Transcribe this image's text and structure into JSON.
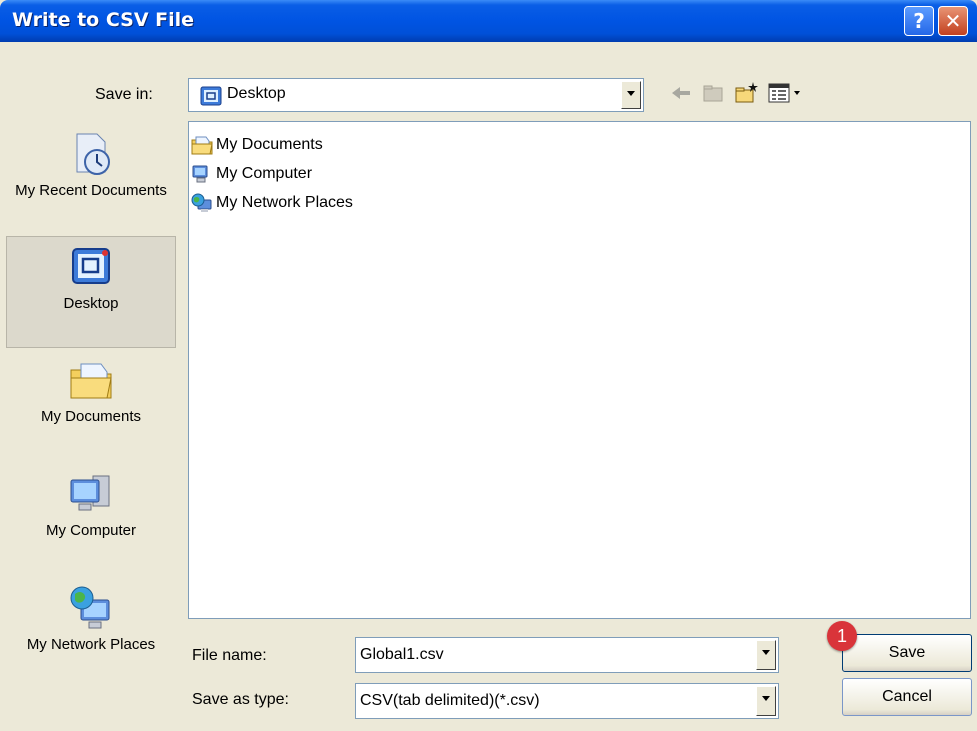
{
  "window": {
    "title": "Write to CSV File",
    "help_label": "?",
    "close_label": "✕"
  },
  "save_in": {
    "label": "Save in:",
    "value": "Desktop",
    "icon": "desktop-icon"
  },
  "toolbar": {
    "back_icon": "back-arrow-icon",
    "up_icon": "up-folder-icon",
    "new_folder_icon": "new-folder-icon",
    "view_menu_icon": "view-menu-icon"
  },
  "places": [
    {
      "label": "My Recent Documents",
      "icon": "recent-documents-icon"
    },
    {
      "label": "Desktop",
      "icon": "desktop-icon",
      "active": true
    },
    {
      "label": "My Documents",
      "icon": "my-documents-icon"
    },
    {
      "label": "My Computer",
      "icon": "my-computer-icon"
    },
    {
      "label": "My Network Places",
      "icon": "network-places-icon"
    }
  ],
  "files": [
    {
      "name": "My Documents",
      "icon": "folder-icon"
    },
    {
      "name": "My Computer",
      "icon": "computer-icon"
    },
    {
      "name": "My Network Places",
      "icon": "network-icon"
    }
  ],
  "file_name": {
    "label": "File name:",
    "value": "Global1.csv"
  },
  "save_type": {
    "label": "Save as type:",
    "value": "CSV(tab delimited)(*.csv)"
  },
  "buttons": {
    "save": "Save",
    "cancel": "Cancel"
  },
  "callout": {
    "number": "1",
    "color": "#d9343a"
  },
  "colors": {
    "titlebar": "#0054e3",
    "dialog_bg": "#ece9d8",
    "selection": "#316ac5"
  }
}
